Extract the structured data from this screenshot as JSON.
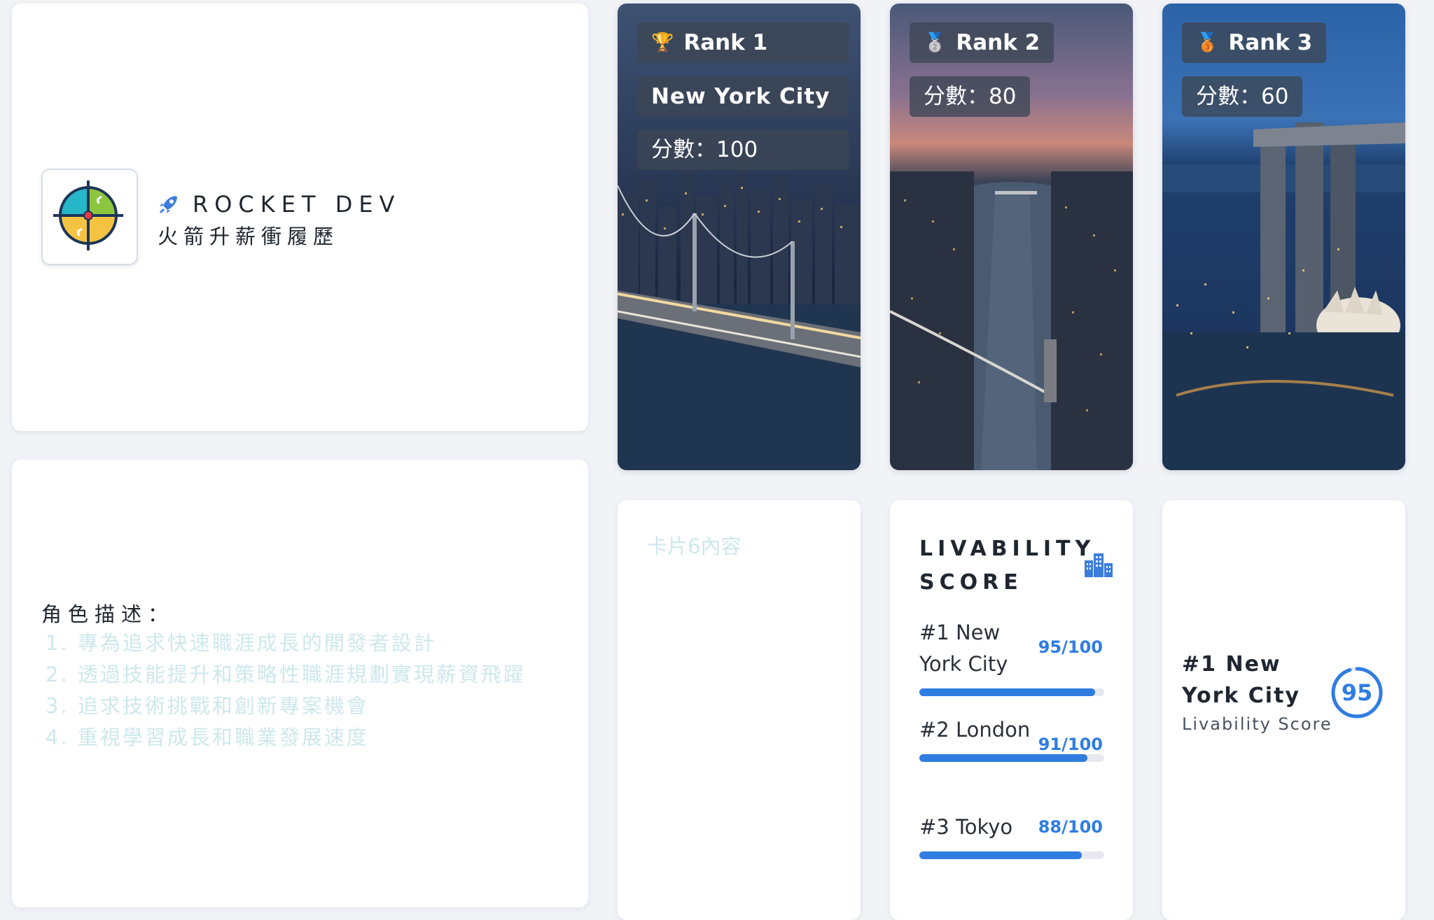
{
  "brand": {
    "name": "ROCKET DEV",
    "subtitle": "火箭升薪衝履歷"
  },
  "role": {
    "title": "角色描述：",
    "items": [
      "1. 專為追求快速職涯成長的開發者設計",
      "2. 透過技能提升和策略性職涯規劃實現薪資飛躍",
      "3. 追求技術挑戰和創新專案機會",
      "4. 重視學習成長和職業發展速度"
    ]
  },
  "rankings": [
    {
      "medal": "🏆",
      "rank": "Rank 1",
      "city": "New York City",
      "score": "分數：100"
    },
    {
      "medal": "🥈",
      "rank": "Rank 2",
      "score": "分數：80"
    },
    {
      "medal": "🥉",
      "rank": "Rank 3",
      "score": "分數：60"
    }
  ],
  "card6": {
    "text": "卡片6內容"
  },
  "livability": {
    "title": "LIVABILITY SCORE",
    "icon": "city-icon",
    "accent": "#2f7de1",
    "rows": [
      {
        "name": "#1 New York City",
        "score": "95/100",
        "value": 95
      },
      {
        "name": "#2 London",
        "score": "91/100",
        "value": 91
      },
      {
        "name": "#3 Tokyo",
        "score": "88/100",
        "value": 88
      }
    ]
  },
  "top_city": {
    "name": "#1 New York City",
    "label": "Livability Score",
    "score": "95",
    "value": 95
  }
}
